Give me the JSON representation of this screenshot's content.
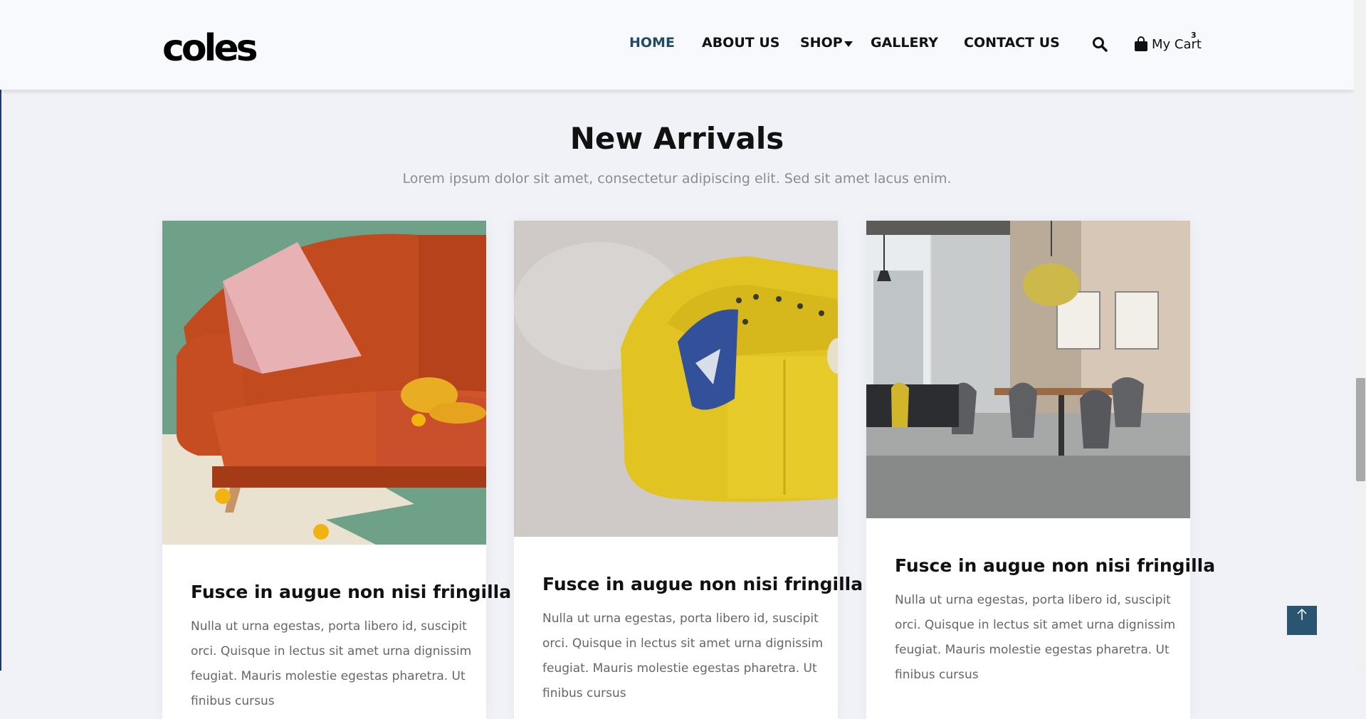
{
  "brand": {
    "logo_text": "coles"
  },
  "nav": {
    "items": [
      {
        "label": "HOME",
        "active": true
      },
      {
        "label": "ABOUT US"
      },
      {
        "label": "SHOP"
      },
      {
        "label": "GALLERY"
      },
      {
        "label": "CONTACT US"
      }
    ],
    "cart_label": "My Cart",
    "cart_count": "3"
  },
  "section": {
    "title": "New Arrivals",
    "subtitle": "Lorem ipsum dolor sit amet, consectetur adipiscing elit. Sed sit amet lacus enim."
  },
  "cards": [
    {
      "title": "Fusce in augue non nisi fringilla",
      "text": "Nulla ut urna egestas, porta libero id, suscipit orci. Quisque in lectus sit amet urna dignissim feugiat. Mauris molestie egestas pharetra. Ut finibus cursus"
    },
    {
      "title": "Fusce in augue non nisi fringilla",
      "text": "Nulla ut urna egestas, porta libero id, suscipit orci. Quisque in lectus sit amet urna dignissim feugiat. Mauris molestie egestas pharetra. Ut finibus cursus"
    },
    {
      "title": "Fusce in augue non nisi fringilla",
      "text": "Nulla ut urna egestas, porta libero id, suscipit orci. Quisque in lectus sit amet urna dignissim feugiat. Mauris molestie egestas pharetra. Ut finibus cursus"
    }
  ],
  "icons": {
    "search": "search-icon",
    "cart": "shopping-bag-icon",
    "back_to_top": "arrow-up-icon"
  },
  "colors": {
    "accent": "#224a63",
    "back_to_top_bg": "#2a5570",
    "page_bg": "#f1f2f7"
  }
}
